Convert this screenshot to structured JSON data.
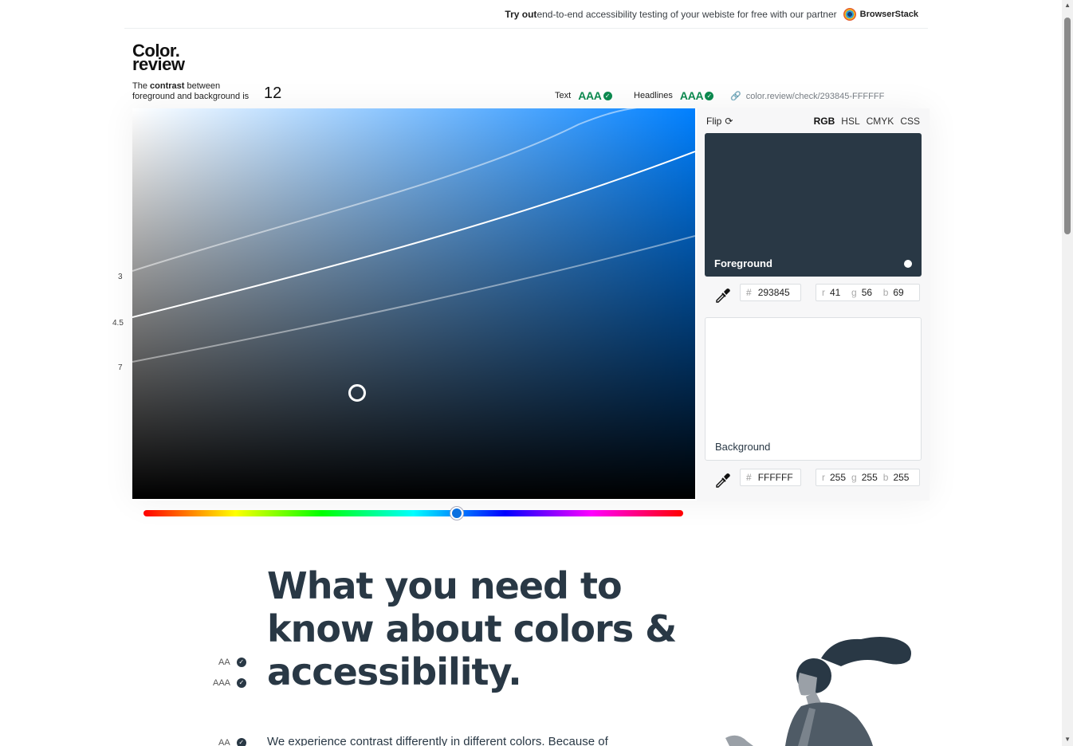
{
  "promo": {
    "prefix": "Try out",
    "text": " end-to-end accessibility testing of your webiste for free with our partner",
    "partner": "BrowserStack"
  },
  "logo": {
    "line1": "Color.",
    "line2": "review"
  },
  "summary": {
    "line1_pre": "The ",
    "line1_bold": "contrast",
    "line1_post": " between",
    "line2": "foreground and background is",
    "ratio": "12"
  },
  "grades": {
    "text_label": "Text",
    "text_grade": "AAA",
    "headlines_label": "Headlines",
    "headlines_grade": "AAA"
  },
  "share_link": "color.review/check/293845-FFFFFF",
  "scale_labels": [
    "3",
    "4.5",
    "7"
  ],
  "panel": {
    "flip_label": "Flip",
    "modes": [
      "RGB",
      "HSL",
      "CMYK",
      "CSS"
    ],
    "active_mode": "RGB",
    "foreground": {
      "label": "Foreground",
      "hex": "293845",
      "r": "41",
      "g": "56",
      "b": "69",
      "color": "#293845"
    },
    "background": {
      "label": "Background",
      "hex": "FFFFFF",
      "r": "255",
      "g": "255",
      "b": "255",
      "color": "#FFFFFF"
    },
    "hash": "#",
    "r_key": "r",
    "g_key": "g",
    "b_key": "b"
  },
  "hero": {
    "line1": "What you need to",
    "line2": "know about colors &",
    "line3": "accessibility."
  },
  "side_badges": [
    "AA",
    "AAA",
    "AA"
  ],
  "body_text": "We experience contrast differently in different colors. Because of",
  "colors": {
    "accent": "#0c8a4f",
    "text": "#293845",
    "hue_knob": "#0a70e0"
  }
}
